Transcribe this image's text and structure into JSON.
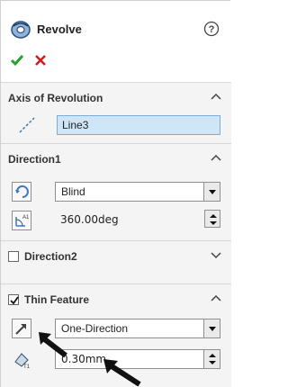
{
  "feature": {
    "title": "Revolve",
    "icon": "revolve-icon",
    "help_icon": "help-icon",
    "ok_icon": "checkmark-icon",
    "cancel_icon": "x-icon",
    "ok_color": "#2aa02a",
    "cancel_color": "#d21c1c"
  },
  "axis_of_revolution": {
    "title": "Axis of Revolution",
    "value": "Line3",
    "expanded": true
  },
  "direction1": {
    "title": "Direction1",
    "end_condition": "Blind",
    "angle": "360.00deg",
    "expanded": true
  },
  "direction2": {
    "title": "Direction2",
    "checked": false,
    "expanded": false
  },
  "thin_feature": {
    "title": "Thin Feature",
    "checked": true,
    "type": "One-Direction",
    "thickness": "0.30mm",
    "expanded": true
  }
}
